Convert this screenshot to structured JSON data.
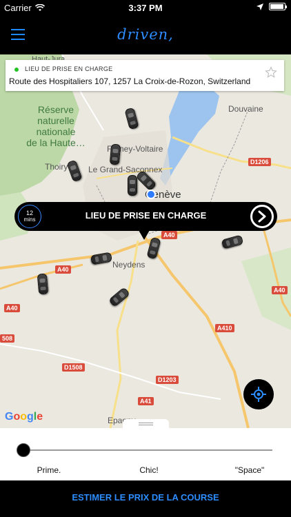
{
  "status_bar": {
    "carrier": "Carrier",
    "time": "3:37 PM",
    "battery_level": 0.95
  },
  "nav": {
    "brand": "driven,",
    "menu_icon": "hamburger-icon"
  },
  "map": {
    "labels": {
      "reserve": "Réserve\nnaturelle\nnationale\nde la Haute…",
      "haut_jura": "Haut-Jura",
      "douvaine": "Douvaine",
      "ferney": "Ferney-Voltaire",
      "thoiry": "Thoiry",
      "grand_saconnex": "Le Grand-Saconnex",
      "geneve": "Genève",
      "neydens": "Neydens",
      "epagny": "Epagny",
      "google": "Google"
    },
    "road_shields": {
      "a40_center": "A40",
      "a40_left": "A40",
      "a40_far_left": "A40",
      "a40_right": "A40",
      "d1206": "D1206",
      "a410": "A410",
      "d1508": "D1508",
      "d1203": "D1203",
      "a41": "A41",
      "road_508": "508"
    }
  },
  "pickup_card": {
    "label": "LIEU DE PRISE EN CHARGE",
    "address": "Route des Hospitaliers 107, 1257 La Croix-de-Rozon, Switzerland",
    "status_color": "#22c322",
    "favorite_icon": "star-outline-icon"
  },
  "pickup_banner": {
    "eta_value": "12",
    "eta_unit": "mins",
    "title": "LIEU DE PRISE EN CHARGE",
    "go_icon": "chevron-right-circle-icon"
  },
  "gps_icon": "crosshair-icon",
  "slider": {
    "tiers": [
      "Prime.",
      "Chic!",
      "\"Space\""
    ],
    "selected_index": 0
  },
  "bottom": {
    "estimate_label": "ESTIMER LE PRIX DE LA COURSE"
  },
  "colors": {
    "accent": "#2d8cff",
    "background": "#000000"
  }
}
